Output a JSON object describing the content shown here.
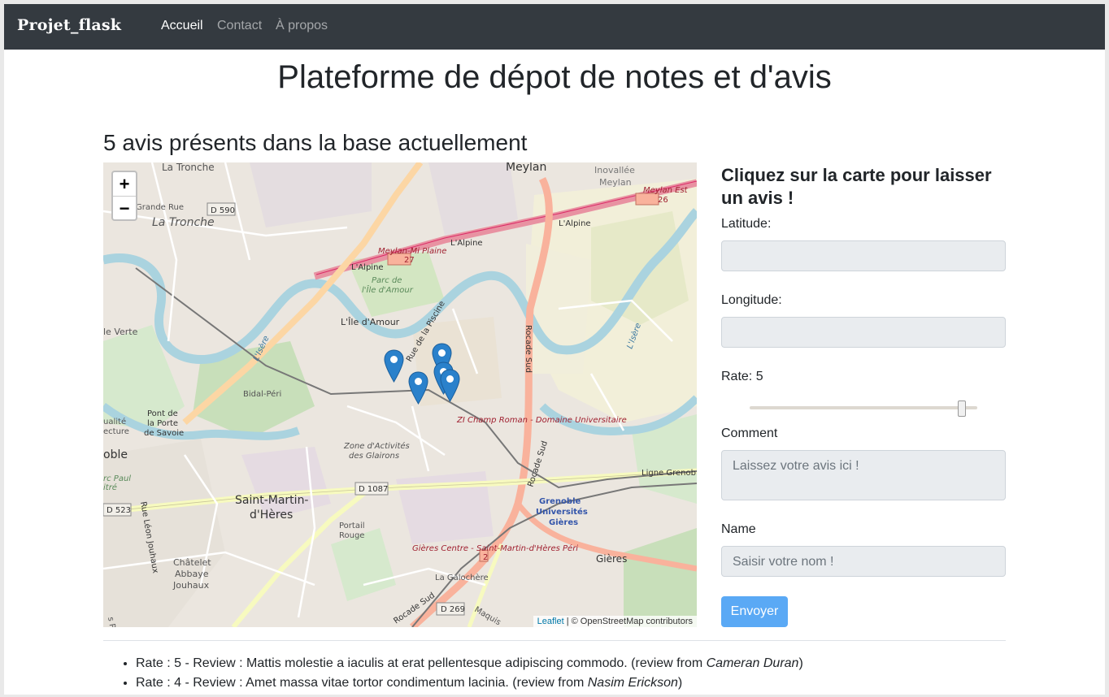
{
  "navbar": {
    "brand": "Projet_flask",
    "links": [
      "Accueil",
      "Contact",
      "À propos"
    ],
    "active": "Accueil"
  },
  "page_title": "Plateforme de dépot de notes et d'avis",
  "count_title": "5 avis présents dans la base actuellement",
  "map": {
    "zoom_in": "+",
    "zoom_out": "−",
    "attribution_link": "Leaflet",
    "attribution_text": "| © OpenStreetMap contributors",
    "labels": {
      "la_tronche_top": "La Tronche",
      "la_tronche": "La Tronche",
      "grande_rue": "Grande Rue",
      "d590": "D 590",
      "meylan": "Meylan",
      "inovallee": "Inovallée",
      "meylan2": "Meylan",
      "meylan_est": "Meylan Est",
      "n26": "26",
      "alpine1": "L'Alpine",
      "alpine2": "L'Alpine",
      "alpine3": "L'Alpine",
      "meylan_mi_plaine": "Meylan-Mi Plaine",
      "n27": "27",
      "parc": "Parc de",
      "ile_amour_parc": "l'Île d'Amour",
      "ile_amour": "L'Île d'Amour",
      "rue_piscine": "Rue de la Piscine",
      "rocade_sud": "Rocade Sud",
      "isere": "L'Isère",
      "isere2": "L'Isère",
      "ile_verte": "le Verte",
      "bidal": "Bidal-Péri",
      "zi": "ZI Champ Roman - Domaine Universitaire",
      "pont": "Pont de",
      "la_porte": "la Porte",
      "savoie": "de Savoie",
      "zone": "Zone d'Activités",
      "glairons": "des Glairons",
      "d1087": "D 1087",
      "rocade_sud2": "Rocade Sud",
      "ligne": "Ligne Grenoble",
      "grenoble": "Grenoble",
      "universites": "Universités",
      "gieres_sta": "Gières",
      "smh1": "Saint-Martin-",
      "smh2": "d'Hères",
      "portail": "Portail",
      "rouge": "Rouge",
      "gieres_centre": "Gières Centre - Saint-Martin-d'Hères Péri",
      "n2": "2",
      "gieres": "Gières",
      "chatelet": "Châtelet",
      "abbaye": "Abbaye",
      "jouhaux": "Jouhaux",
      "d523": "D 523",
      "rue_leon": "Rue Léon Jouhaux",
      "la_galochere": "La Galochère",
      "d269": "D 269",
      "rocade_sud3": "Rocade Sud",
      "maquis": "Maquis",
      "oble": "oble",
      "parc_paul": "rc Paul",
      "itre": "itré",
      "qualite": "ualité",
      "ecture": "ecture",
      "perrot": "s Perrot"
    },
    "markers": [
      {
        "lat_label": "marker-1"
      },
      {
        "lat_label": "marker-2"
      },
      {
        "lat_label": "marker-3"
      },
      {
        "lat_label": "marker-4"
      },
      {
        "lat_label": "marker-5"
      }
    ]
  },
  "form": {
    "title": "Cliquez sur la carte pour laisser un avis !",
    "latitude_label": "Latitude:",
    "longitude_label": "Longitude:",
    "rate_label": "Rate: 5",
    "rate_value": 5,
    "rate_min": 0,
    "rate_max": 5,
    "comment_label": "Comment",
    "comment_placeholder": "Laissez votre avis ici !",
    "name_label": "Name",
    "name_placeholder": "Saisir votre nom !",
    "submit": "Envoyer"
  },
  "reviews": [
    {
      "prefix": "Rate : 5 - Review : Mattis molestie a iaculis at erat pellentesque adipiscing commodo. (review from ",
      "author": "Cameran Duran",
      "suffix": ")"
    },
    {
      "prefix": "Rate : 4 - Review : Amet massa vitae tortor condimentum lacinia. (review from ",
      "author": "Nasim Erickson",
      "suffix": ")"
    }
  ],
  "colors": {
    "navbar": "#343a40",
    "button": "#5aa9f5",
    "marker": "#2a81cb",
    "river": "#aad3df",
    "motorway": "#e892a2",
    "trunk": "#f9b29c"
  }
}
